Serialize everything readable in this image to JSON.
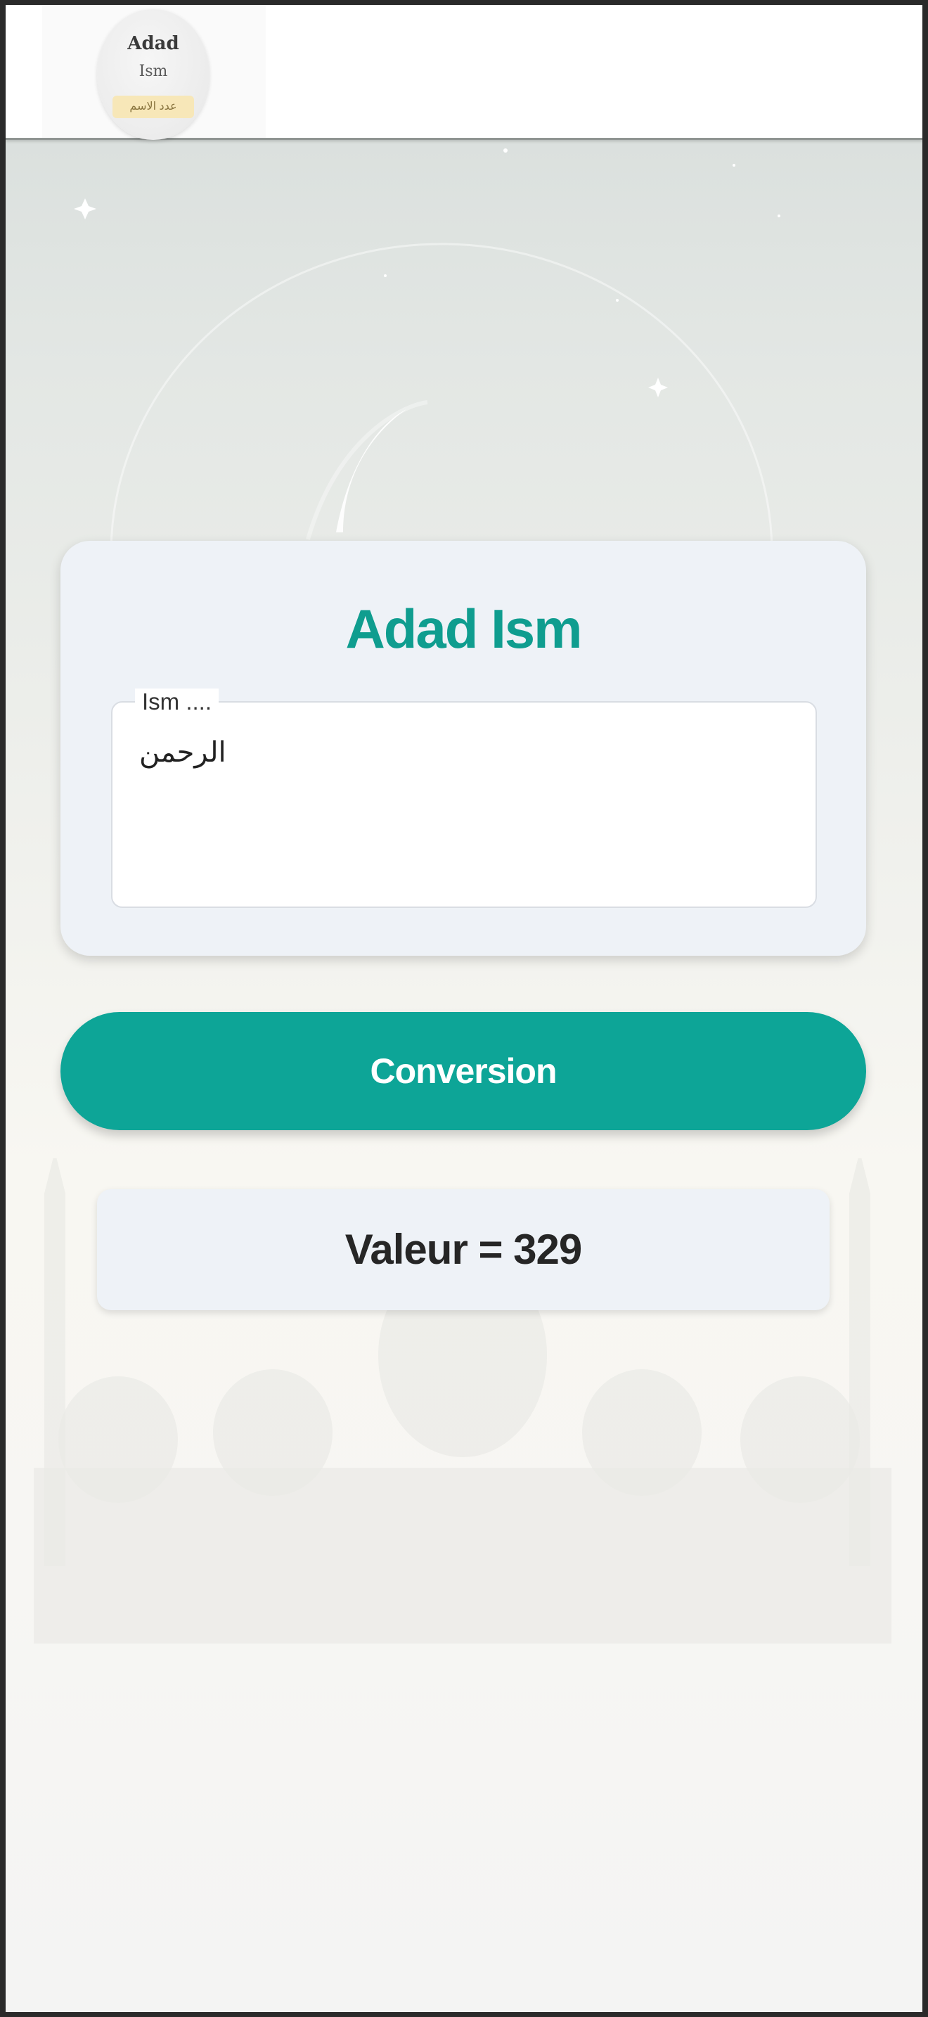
{
  "header": {
    "logo": {
      "line1": "Adad",
      "line2": "Ism",
      "badge": "عدد الاسم"
    }
  },
  "card": {
    "title": "Adad Ism",
    "input": {
      "label": "Ism ....",
      "value": "الرحمن"
    }
  },
  "convert_button": {
    "label": "Conversion"
  },
  "result": {
    "text": "Valeur = 329"
  },
  "colors": {
    "accent": "#0da597",
    "title": "#0f9d8f",
    "card_bg": "#eef2f7",
    "result_text": "#262626"
  }
}
